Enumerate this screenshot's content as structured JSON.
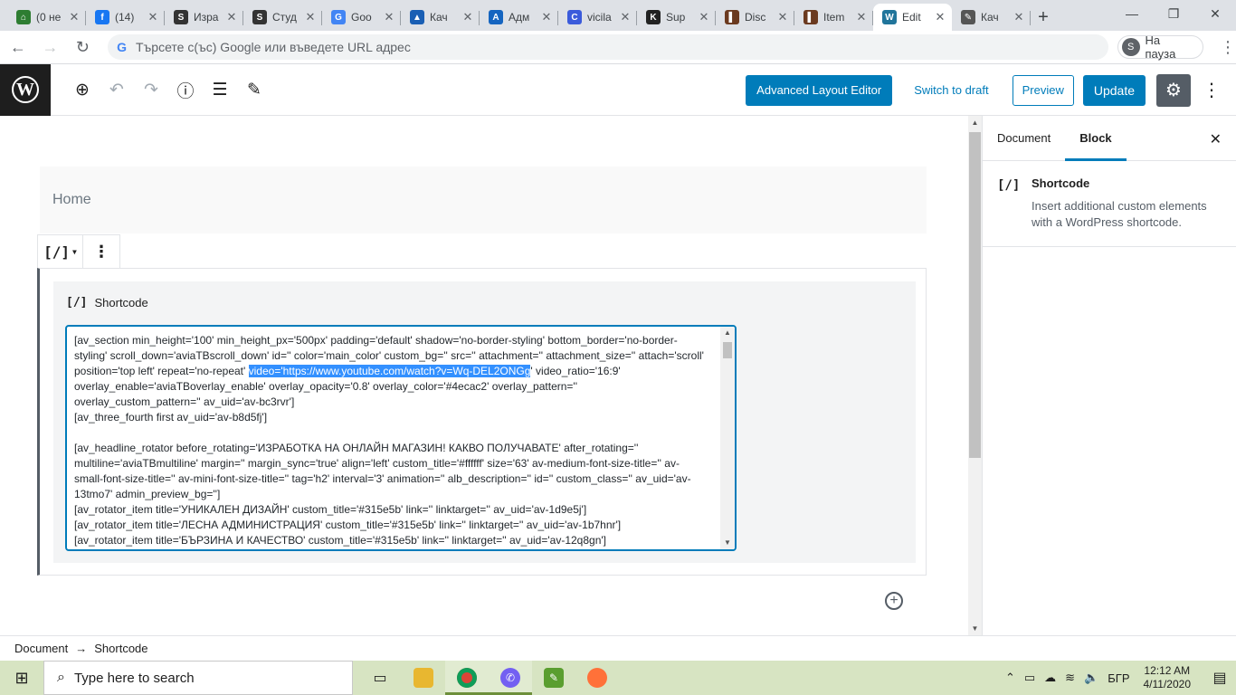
{
  "browser": {
    "tabs": [
      {
        "label": "(0 не",
        "icon": "home-icon",
        "color": "#2e7d32",
        "glyph": "⌂"
      },
      {
        "label": "(14)",
        "icon": "facebook-icon",
        "color": "#1877f2",
        "glyph": "f"
      },
      {
        "label": "Изра",
        "icon": "sw-icon",
        "color": "#333333",
        "glyph": "S"
      },
      {
        "label": "Студ",
        "icon": "sw-icon",
        "color": "#333333",
        "glyph": "S"
      },
      {
        "label": "Goo",
        "icon": "translate-icon",
        "color": "#4285f4",
        "glyph": "G"
      },
      {
        "label": "Кач",
        "icon": "bank-icon",
        "color": "#1a5fb4",
        "glyph": "▲"
      },
      {
        "label": "Адм",
        "icon": "a-icon",
        "color": "#1565c0",
        "glyph": "A"
      },
      {
        "label": "vicila",
        "icon": "c-icon",
        "color": "#3b5bdb",
        "glyph": "C"
      },
      {
        "label": "Sup",
        "icon": "k-icon",
        "color": "#222222",
        "glyph": "K"
      },
      {
        "label": "Disc",
        "icon": "theme-icon",
        "color": "#6b3a1f",
        "glyph": "▌"
      },
      {
        "label": "Item",
        "icon": "theme-icon",
        "color": "#6b3a1f",
        "glyph": "▌"
      },
      {
        "label": "Edit",
        "icon": "wordpress-icon",
        "color": "#21759b",
        "glyph": "W",
        "active": true
      },
      {
        "label": "Кач",
        "icon": "tool-icon",
        "color": "#555555",
        "glyph": "✎"
      }
    ],
    "new_tab": "+",
    "window": {
      "minimize": "—",
      "maximize": "❐",
      "close": "✕"
    },
    "address_placeholder": "Търсете с(ъс) Google или въведете URL адрес",
    "profile_initial": "S",
    "profile_label": "На пауза"
  },
  "wp_header": {
    "advanced_layout_editor": "Advanced Layout Editor",
    "switch_to_draft": "Switch to draft",
    "preview": "Preview",
    "update": "Update"
  },
  "editor": {
    "title": "Home",
    "block_icon": "[/]",
    "block_name": "Shortcode",
    "shortcode_before": "[av_section min_height='100' min_height_px='500px' padding='default' shadow='no-border-styling' bottom_border='no-border-styling' scroll_down='aviaTBscroll_down' id='' color='main_color' custom_bg='' src='' attachment='' attachment_size='' attach='scroll' position='top left' repeat='no-repeat' ",
    "shortcode_selected": "video='https://www.youtube.com/watch?v=Wq-DEL2ONGg",
    "shortcode_after": "' video_ratio='16:9' overlay_enable='aviaTBoverlay_enable' overlay_opacity='0.8' overlay_color='#4ecac2' overlay_pattern='' overlay_custom_pattern='' av_uid='av-bc3rvr']\n[av_three_fourth first av_uid='av-b8d5fj']\n\n[av_headline_rotator before_rotating='ИЗРАБОТКА НА ОНЛАЙН МАГАЗИН! КАКВО ПОЛУЧАВАТЕ' after_rotating='' multiline='aviaTBmultiline' margin='' margin_sync='true' align='left' custom_title='#ffffff' size='63' av-medium-font-size-title='' av-small-font-size-title='' av-mini-font-size-title='' tag='h2' interval='3' animation='' alb_description='' id='' custom_class='' av_uid='av-13tmo7' admin_preview_bg='']\n[av_rotator_item title='УНИКАЛЕН ДИЗАЙН' custom_title='#315e5b' link='' linktarget='' av_uid='av-1d9e5j']\n[av_rotator_item title='ЛЕСНА АДМИНИСТРАЦИЯ' custom_title='#315e5b' link='' linktarget='' av_uid='av-1b7hnr']\n[av_rotator_item title='БЪРЗИНА И КАЧЕСТВО' custom_title='#315e5b' link='' linktarget='' av_uid='av-12q8gn']"
  },
  "sidebar": {
    "tab_document": "Document",
    "tab_block": "Block",
    "block_icon": "[/]",
    "block_title": "Shortcode",
    "block_description": "Insert additional custom elements with a WordPress shortcode."
  },
  "breadcrumb": {
    "root": "Document",
    "arrow": "→",
    "current": "Shortcode"
  },
  "taskbar": {
    "search_placeholder": "Type here to search",
    "language": "БГР",
    "time": "12:12 AM",
    "date": "4/11/2020"
  },
  "colors": {
    "accent": "#007cba",
    "selection": "#3390ff",
    "taskbar": "#d7e4c2"
  }
}
